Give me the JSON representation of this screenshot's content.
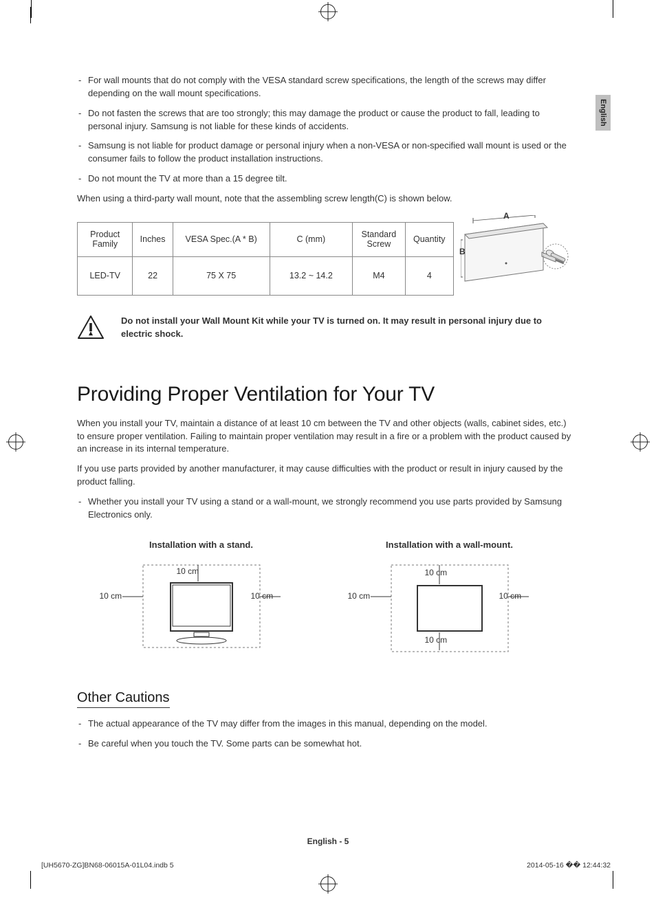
{
  "sideTab": "English",
  "bullets_top": [
    "For wall mounts that do not comply with the VESA standard screw specifications, the length of the screws may differ depending on the wall mount specifications.",
    "Do not fasten the screws that are too strongly; this may damage the product or cause the product to fall, leading to personal injury. Samsung is not liable for these kinds of accidents.",
    "Samsung is not liable for product damage or personal injury when a non-VESA or non-specified wall mount is used or the consumer fails to follow the product installation instructions.",
    "Do not mount the TV at more than a 15 degree tilt."
  ],
  "note_third_party": "When using a third-party wall mount, note that the assembling screw length(C) is shown below.",
  "table": {
    "headers": [
      "Product Family",
      "Inches",
      "VESA Spec.(A * B)",
      "C (mm)",
      "Standard Screw",
      "Quantity"
    ],
    "row": [
      "LED-TV",
      "22",
      "75 X 75",
      "13.2 ~ 14.2",
      "M4",
      "4"
    ]
  },
  "diagram_labels": {
    "A": "A",
    "B": "B"
  },
  "warning_text": "Do not install your Wall Mount Kit while your TV is turned on. It may result in personal injury due to electric shock.",
  "h1": "Providing Proper Ventilation for Your TV",
  "vent_p1": "When you install your TV, maintain a distance of at least 10 cm between the TV and other objects (walls, cabinet sides, etc.) to ensure proper ventilation. Failing to maintain proper ventilation may result in a fire or a problem with the product caused by an increase in its internal temperature.",
  "vent_p2": "If you use parts provided by another manufacturer, it may cause difficulties with the product or result in injury caused by the product falling.",
  "vent_bullet": "Whether you install your TV using a stand or a wall-mount, we strongly recommend you use parts provided by Samsung Electronics only.",
  "install": {
    "stand_title": "Installation with a stand.",
    "wall_title": "Installation with a wall-mount.",
    "dist": "10 cm"
  },
  "h2": "Other Cautions",
  "cautions": [
    "The actual appearance of the TV may differ from the images in this manual, depending on the model.",
    "Be careful when you touch the TV. Some parts can be somewhat hot."
  ],
  "footer": {
    "center": "English - 5",
    "left": "[UH5670-ZG]BN68-06015A-01L04.indb   5",
    "right": "2014-05-16   �� 12:44:32"
  }
}
